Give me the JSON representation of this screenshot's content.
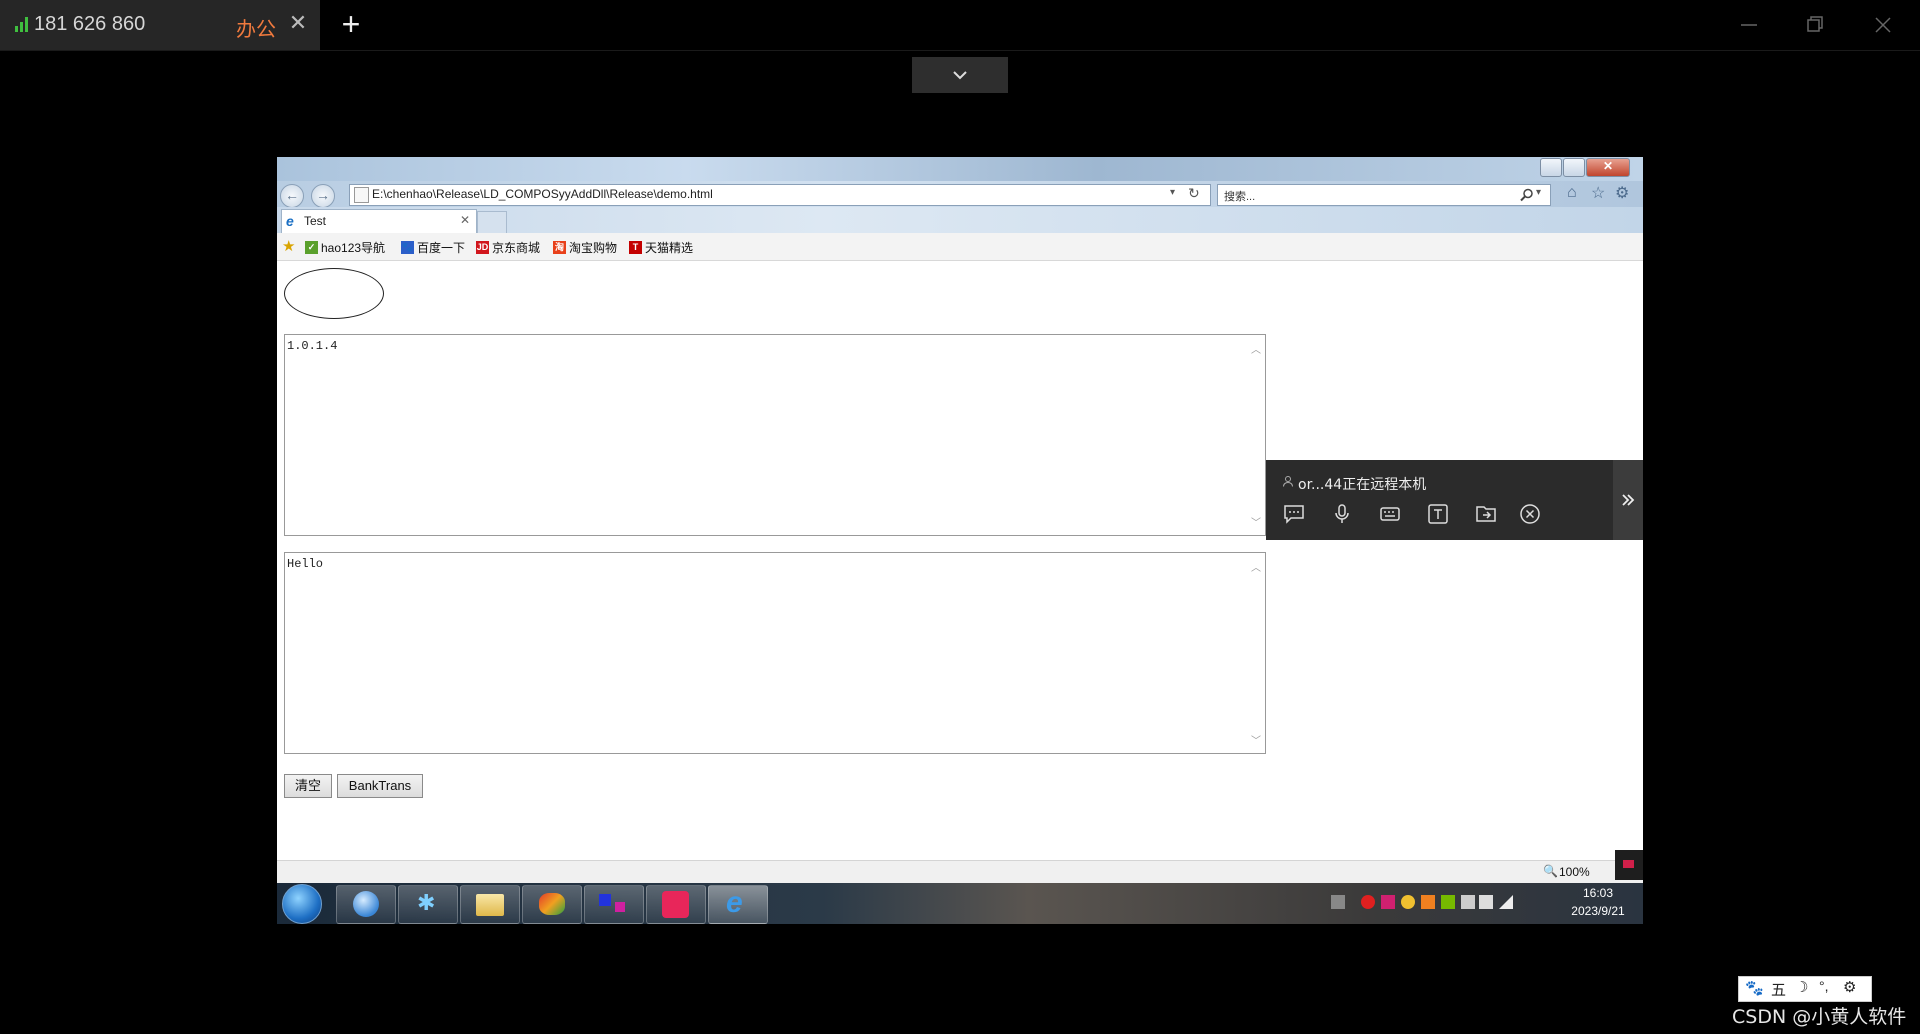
{
  "remote_app": {
    "connection_id": "181 626 860",
    "tab_label": "办公",
    "tab_close": "✕",
    "new_tab": "+"
  },
  "browser": {
    "address": "E:\\chenhao\\Release\\LD_COMPOSyyAddDll\\Release\\demo.html",
    "search_placeholder": "搜索...",
    "tab_title": "Test",
    "tab_close": "✕",
    "favorites": [
      {
        "label": "hao123导航",
        "icon": "hao123-icon"
      },
      {
        "label": "百度一下",
        "icon": "baidu-icon"
      },
      {
        "label": "京东商城",
        "icon": "jd-icon",
        "badge": "JD"
      },
      {
        "label": "淘宝购物",
        "icon": "taobao-icon",
        "badge": "淘"
      },
      {
        "label": "天猫精选",
        "icon": "tmall-icon",
        "badge": "T"
      }
    ],
    "zoom": "100%"
  },
  "page": {
    "textarea1_value": "1.0.1.4",
    "textarea2_value": "Hello",
    "clear_button": "清空",
    "banktrans_button": "BankTrans"
  },
  "taskbar": {
    "time": "16:03",
    "date": "2023/9/21"
  },
  "remote_toolbar": {
    "status": "or...44正在远程本机"
  },
  "watermark": "CSDN @小黄人软件",
  "ime": {
    "label": "五"
  },
  "colors": {
    "accent_tab": "#f07a3e",
    "signal": "#3fbf3f"
  }
}
